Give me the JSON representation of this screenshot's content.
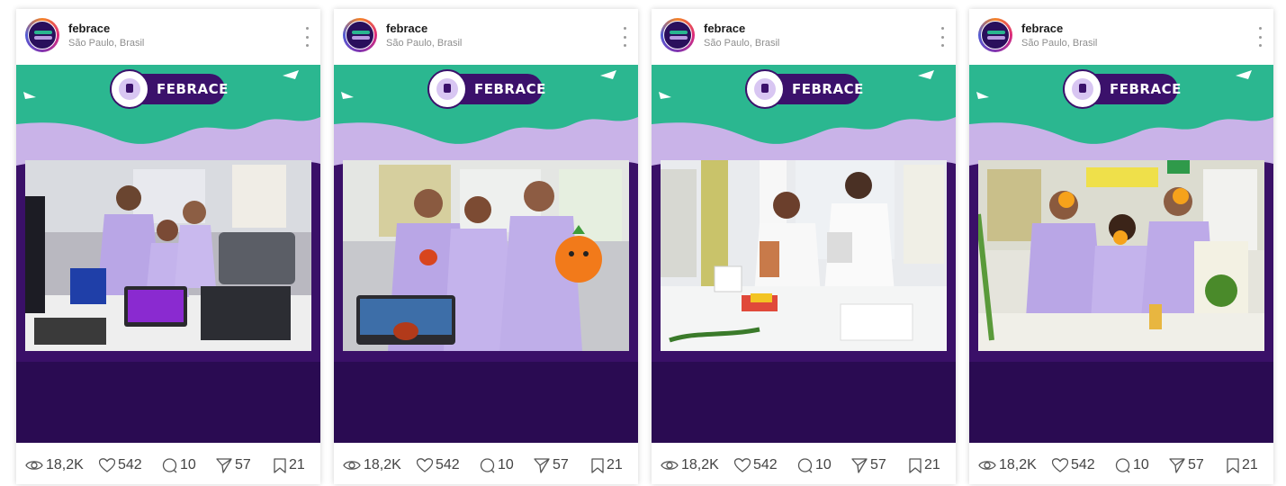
{
  "account": {
    "username": "febrace",
    "location": "São Paulo, Brasil"
  },
  "brand": {
    "logo_text": "FEBRACE",
    "colors": {
      "green": "#2bb790",
      "lilac": "#c9b3e8",
      "purple": "#3b116b",
      "dark_purple": "#2a0b52"
    }
  },
  "posts": [
    {
      "photo_description_icon": "students-with-laptop-and-case-photo",
      "stats": {
        "views": "18,2K",
        "likes": "542",
        "comments": "10",
        "shares": "57",
        "saves": "21"
      }
    },
    {
      "photo_description_icon": "three-students-with-plush-orange-photo",
      "stats": {
        "views": "18,2K",
        "likes": "542",
        "comments": "10",
        "shares": "57",
        "saves": "21"
      }
    },
    {
      "photo_description_icon": "two-students-in-lab-coats-photo",
      "stats": {
        "views": "18,2K",
        "likes": "542",
        "comments": "10",
        "shares": "57",
        "saves": "21"
      }
    },
    {
      "photo_description_icon": "three-students-with-orange-slices-photo",
      "stats": {
        "views": "18,2K",
        "likes": "542",
        "comments": "10",
        "shares": "57",
        "saves": "21"
      }
    }
  ],
  "icons": {
    "views": "eye-icon",
    "likes": "heart-icon",
    "comments": "comment-icon",
    "shares": "send-icon",
    "saves": "bookmark-icon",
    "more": "more-vertical-icon"
  }
}
